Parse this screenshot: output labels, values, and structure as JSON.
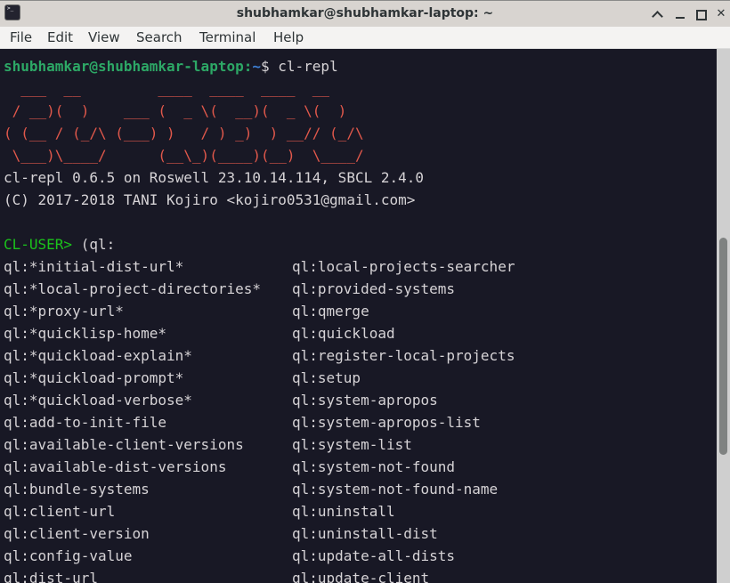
{
  "window": {
    "title": "shubhamkar@shubhamkar-laptop: ~",
    "app_icon": "terminal-icon",
    "controls": {
      "shade": "chevron-up-icon",
      "minimize": "minimize-icon",
      "maximize": "maximize-icon",
      "close": "close-icon"
    }
  },
  "menubar": {
    "items": [
      "File",
      "Edit",
      "View",
      "Search",
      "Terminal",
      "Help"
    ]
  },
  "terminal": {
    "shell_prompt": {
      "user_host": "shubhamkar@shubhamkar-laptop",
      "separator": ":",
      "path": "~",
      "symbol": "$ ",
      "command": "cl-repl"
    },
    "ascii_art": [
      "  ___  __         ____  ____  ____  __",
      " / __)(  )    ___ (  _ \\(  __)(  _ \\(  )",
      "( (__ / (_/\\ (___) )   / ) _)  ) __// (_/\\",
      " \\___)\\____/      (__\\_)(____)(__)  \\____/"
    ],
    "version_line": "cl-repl 0.6.5 on Roswell 23.10.14.114, SBCL 2.4.0",
    "copyright_line": "(C) 2017-2018 TANI Kojiro <kojiro0531@gmail.com>",
    "repl_prompt": "CL-USER>",
    "repl_input": " (ql:",
    "completions_left": [
      "ql:*initial-dist-url*",
      "ql:*local-project-directories*",
      "ql:*proxy-url*",
      "ql:*quicklisp-home*",
      "ql:*quickload-explain*",
      "ql:*quickload-prompt*",
      "ql:*quickload-verbose*",
      "ql:add-to-init-file",
      "ql:available-client-versions",
      "ql:available-dist-versions",
      "ql:bundle-systems",
      "ql:client-url",
      "ql:client-version",
      "ql:config-value",
      "ql:dist-url"
    ],
    "completions_right": [
      "ql:local-projects-searcher",
      "ql:provided-systems",
      "ql:qmerge",
      "ql:quickload",
      "ql:register-local-projects",
      "ql:setup",
      "ql:system-apropos",
      "ql:system-apropos-list",
      "ql:system-list",
      "ql:system-not-found",
      "ql:system-not-found-name",
      "ql:uninstall",
      "ql:uninstall-dist",
      "ql:update-all-dists",
      "ql:update-client"
    ]
  },
  "colors": {
    "terminal_bg": "#181825",
    "prompt_user": "#2da866",
    "prompt_path": "#3d7ed3",
    "ascii_art": "#e1584b",
    "repl_prompt": "#1bc31b",
    "text": "#d6d3d6"
  }
}
